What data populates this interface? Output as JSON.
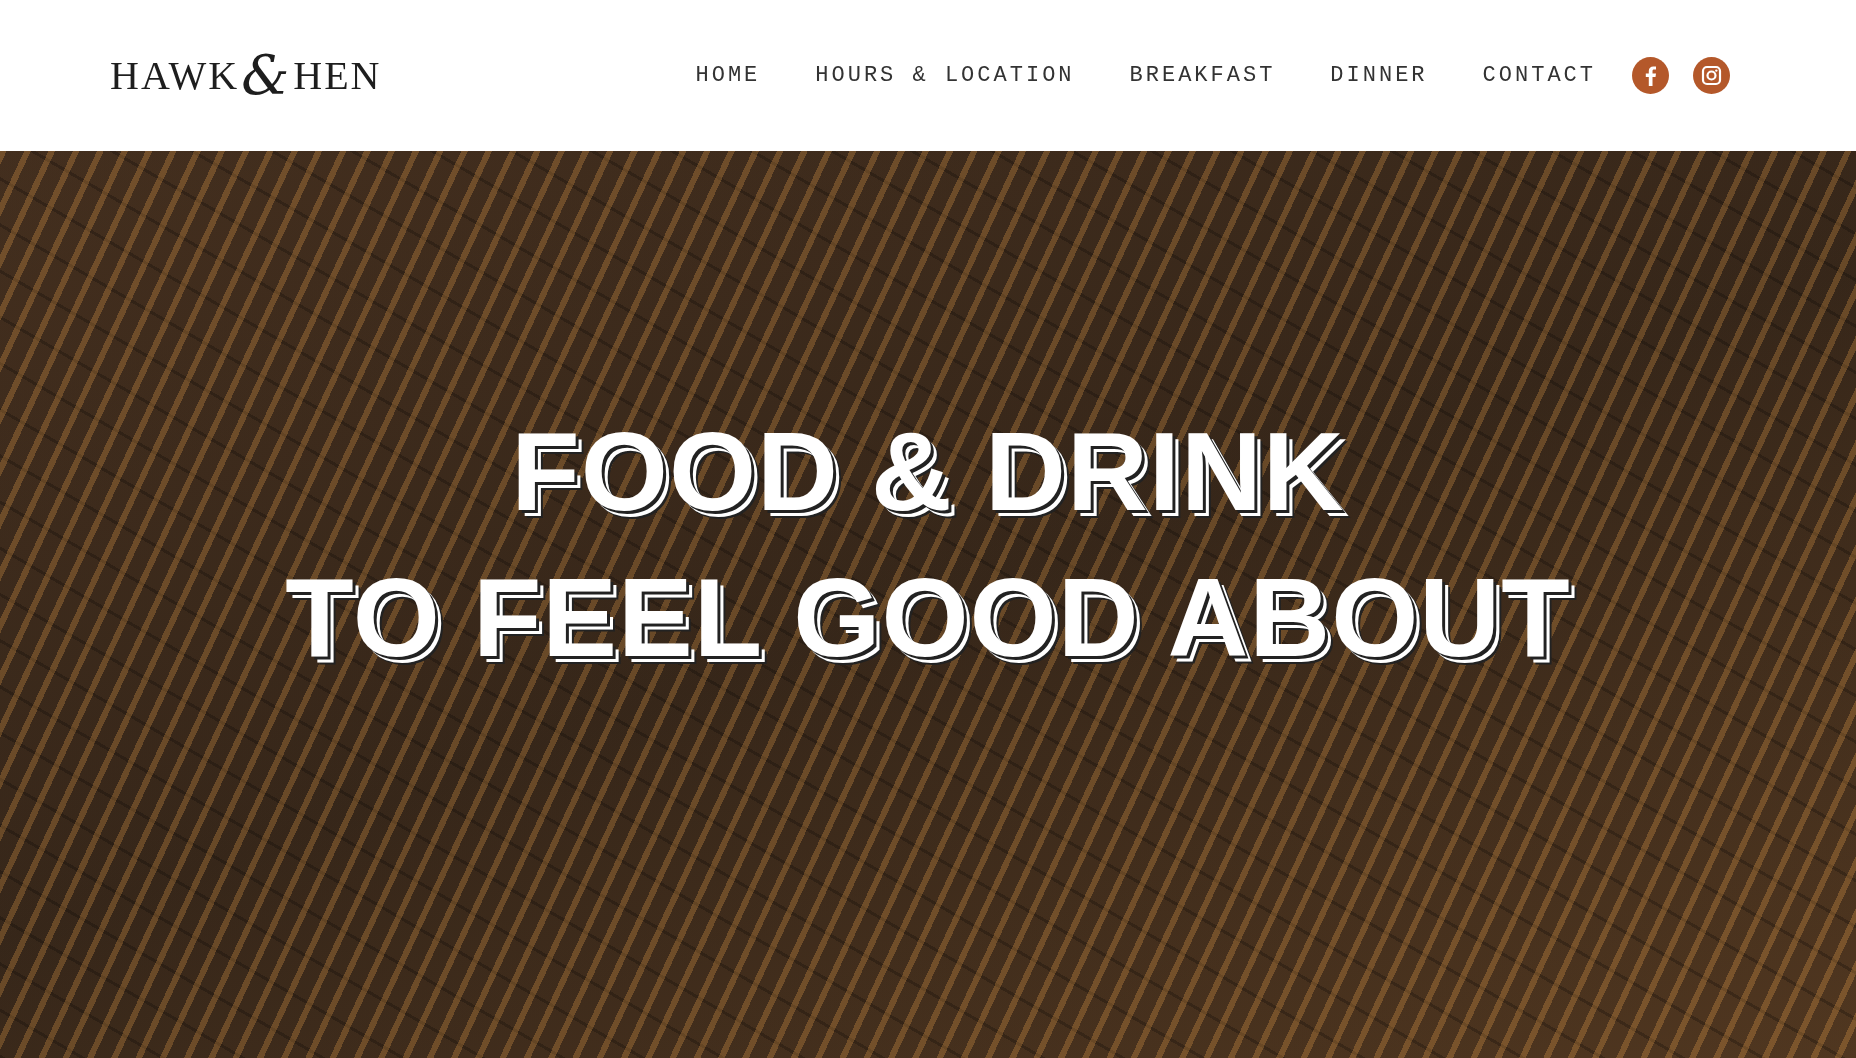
{
  "header": {
    "logo": [
      "HAWK",
      "&",
      "HEN"
    ],
    "nav": [
      {
        "label": "HOME"
      },
      {
        "label": "HOURS & LOCATION"
      },
      {
        "label": "BREAKFAST"
      },
      {
        "label": "DINNER"
      },
      {
        "label": "CONTACT"
      }
    ],
    "social": [
      {
        "kind": "letter-f"
      },
      {
        "kind": "camera"
      }
    ]
  },
  "hero": {
    "headline": [
      "FOOD & DRINK",
      "TO FEEL GOOD ABOUT"
    ]
  }
}
